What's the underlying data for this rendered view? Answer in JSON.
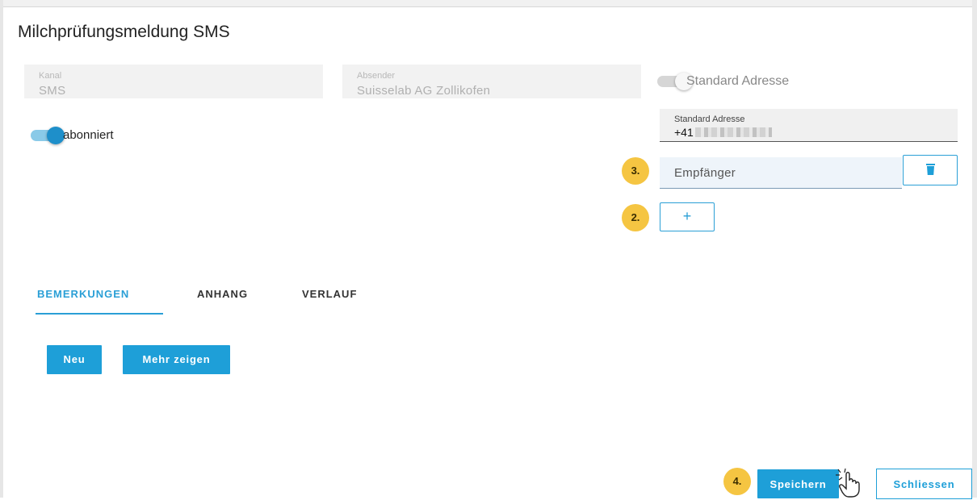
{
  "dialog": {
    "title": "Milchprüfungsmeldung SMS"
  },
  "kanal": {
    "label": "Kanal",
    "value": "SMS"
  },
  "absender": {
    "label": "Absender",
    "value": "Suisselab AG Zollikofen"
  },
  "standard_toggle": {
    "label": "Standard Adresse",
    "on": false
  },
  "abonniert_toggle": {
    "label": "abonniert",
    "on": true
  },
  "standard_address": {
    "label": "Standard Adresse",
    "value": "+41"
  },
  "recipient": {
    "placeholder": "Empfänger"
  },
  "add_button": {
    "label": "+"
  },
  "badges": {
    "step2": "2.",
    "step3": "3.",
    "step4": "4."
  },
  "tabs": [
    {
      "label": "BEMERKUNGEN",
      "active": true
    },
    {
      "label": "ANHANG",
      "active": false
    },
    {
      "label": "VERLAUF",
      "active": false
    }
  ],
  "actions": {
    "new_label": "Neu",
    "more_label": "Mehr zeigen"
  },
  "footer": {
    "save_label": "Speichern",
    "close_label": "Schliessen"
  },
  "colors": {
    "accent": "#1e9fd8",
    "badge": "#f5c542",
    "toggle_on": "#2a9fd6",
    "toggle_off": "#d6d6d6"
  },
  "icons": {
    "delete": "trash-icon",
    "cursor": "hand-pointer-icon"
  }
}
